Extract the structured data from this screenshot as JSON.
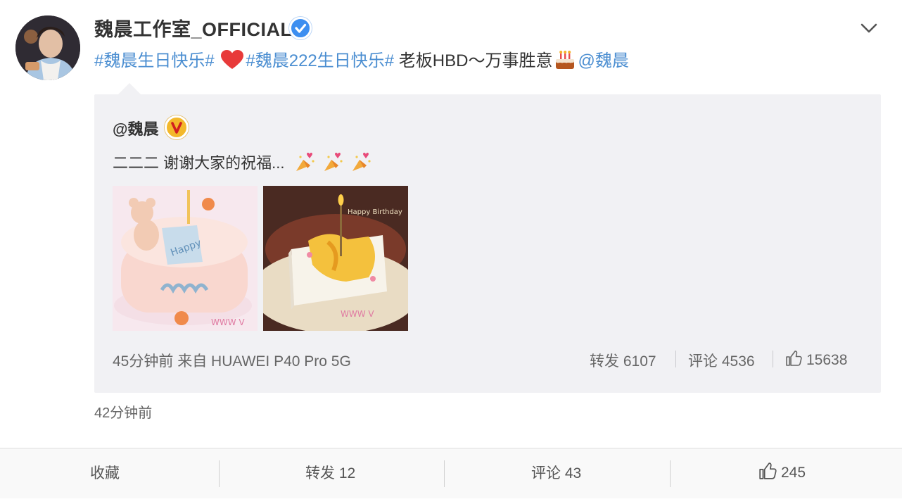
{
  "post": {
    "username": "魏晨工作室_OFFICIAL",
    "text": {
      "tag1": "#魏晨生日快乐#",
      "tag2": "#魏晨222生日快乐#",
      "body": " 老板HBD～万事胜意",
      "mention": "@魏晨"
    },
    "time": "42分钟前"
  },
  "repost": {
    "username": "@魏晨",
    "text": "二二二 谢谢大家的祝福...",
    "meta": "45分钟前 来自 HUAWEI P40 Pro 5G",
    "forward": "转发 6107",
    "comment": "评论 4536",
    "like": "15638",
    "photos": [
      {
        "icon": "cake-photo-bear"
      },
      {
        "icon": "cake-photo-candle"
      }
    ]
  },
  "footer": {
    "favorite": "收藏",
    "forward": "转发 12",
    "comment": "评论 43",
    "like": "245"
  },
  "colors": {
    "link": "#4b8ed1",
    "verified_blue": "#3c8ef0",
    "verified_gold": "#f3b82a",
    "repost_bg": "#f1f1f4"
  }
}
